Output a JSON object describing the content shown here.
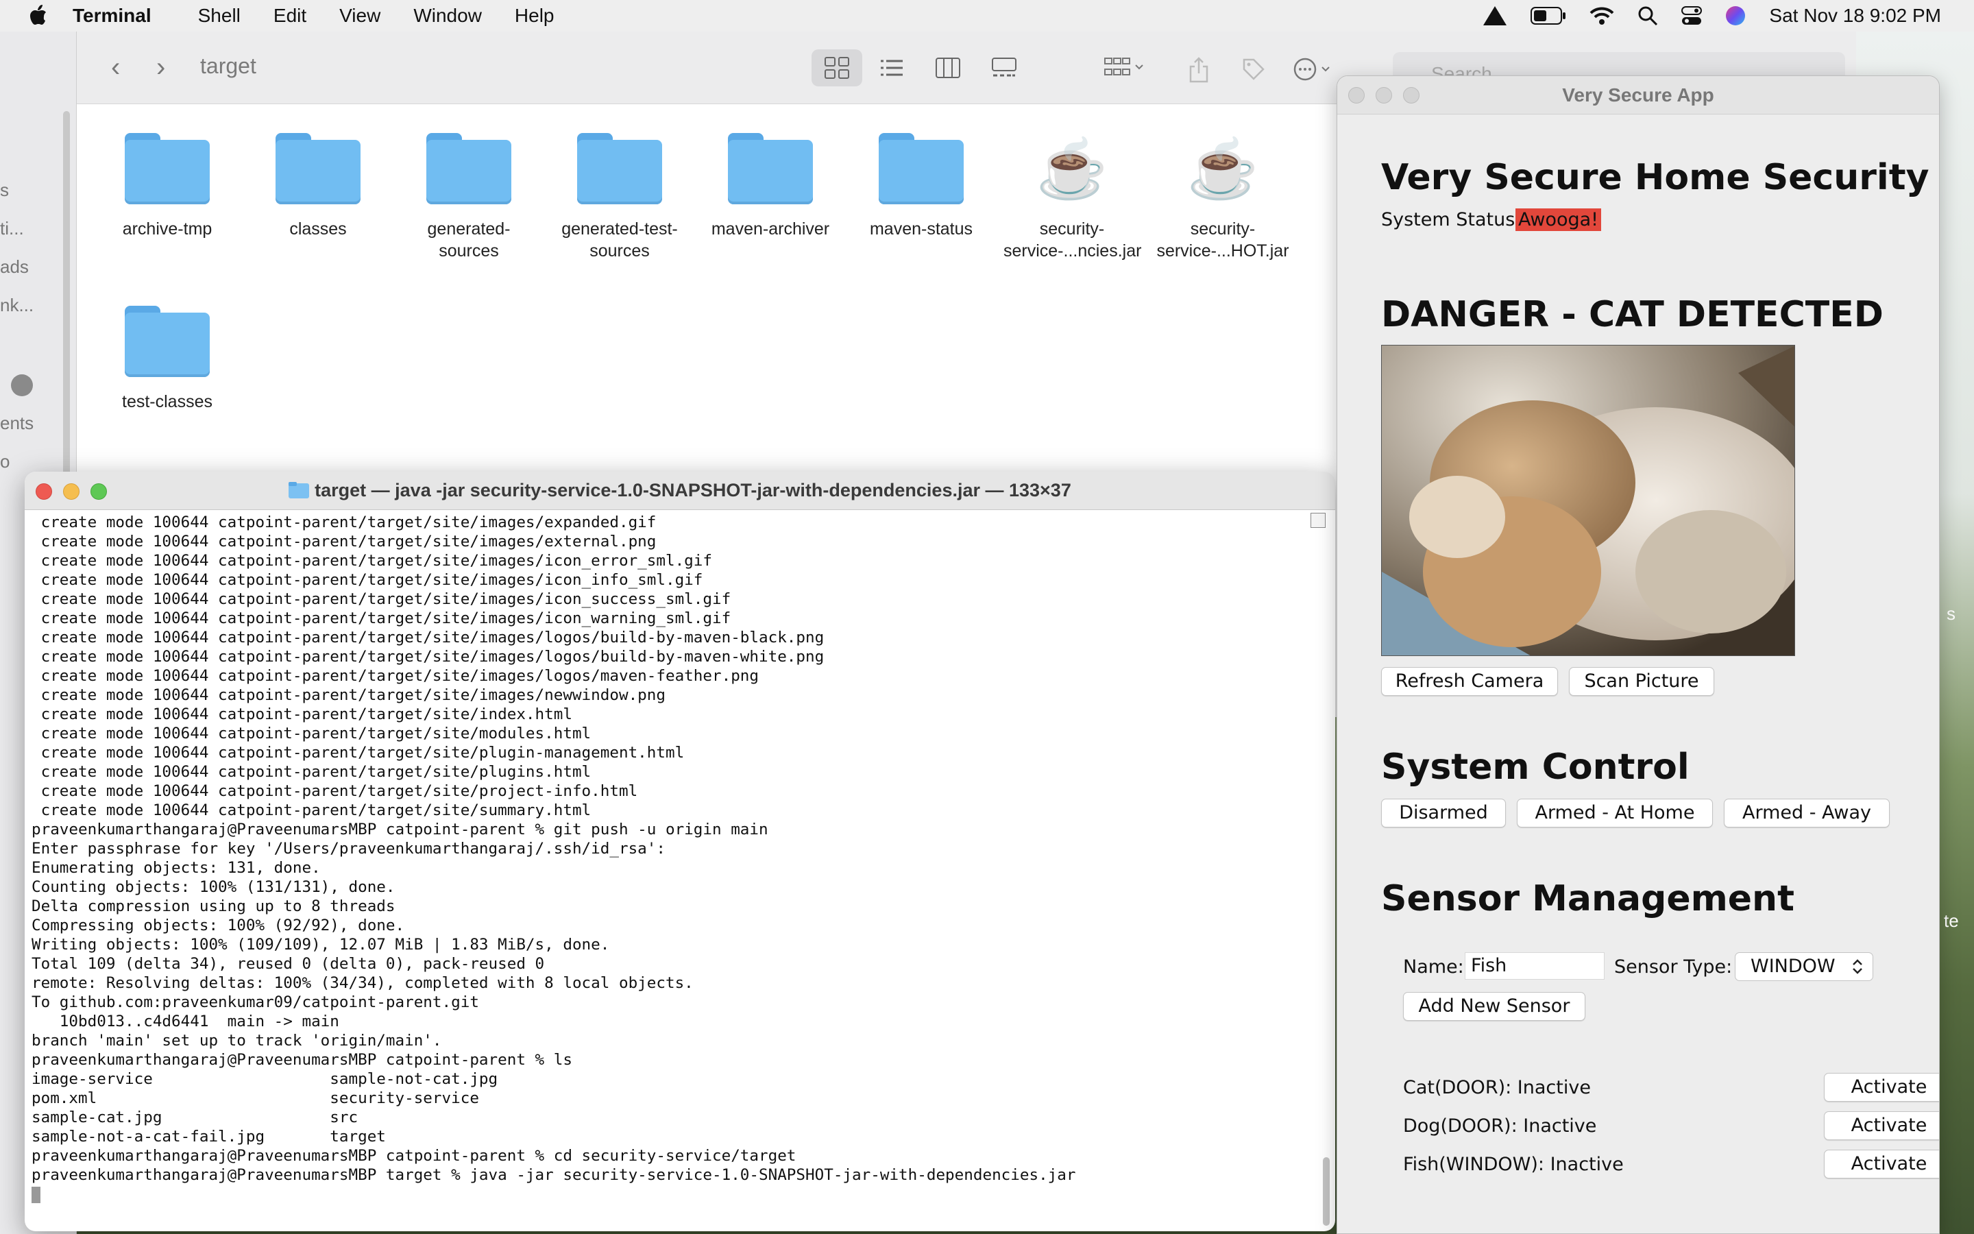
{
  "menubar": {
    "app_name": "Terminal",
    "menus": [
      "Shell",
      "Edit",
      "View",
      "Window",
      "Help"
    ],
    "clock": "Sat Nov 18  9:02 PM",
    "status_icons": [
      "warning-icon",
      "battery-icon",
      "wifi-icon",
      "search-icon",
      "control-center-icon",
      "siri-icon"
    ]
  },
  "sidebar": {
    "fragments": [
      "s",
      "ti...",
      "ads",
      "nk...",
      "ents",
      "o"
    ]
  },
  "finder": {
    "title": "target",
    "search_placeholder": "Search",
    "items": [
      {
        "label": "archive-tmp",
        "kind": "folder"
      },
      {
        "label": "classes",
        "kind": "folder"
      },
      {
        "label": "generated-sources",
        "line1": "generated-",
        "line2": "sources",
        "kind": "folder"
      },
      {
        "label": "generated-test-sources",
        "line1": "generated-test-",
        "line2": "sources",
        "kind": "folder"
      },
      {
        "label": "maven-archiver",
        "kind": "folder"
      },
      {
        "label": "maven-status",
        "kind": "folder"
      },
      {
        "label": "security-service-...ncies.jar",
        "line1": "security-",
        "line2": "service-...ncies.jar",
        "kind": "jar"
      },
      {
        "label": "security-service-...HOT.jar",
        "line1": "security-",
        "line2": "service-...HOT.jar",
        "kind": "jar"
      },
      {
        "label": "test-classes",
        "kind": "folder"
      }
    ]
  },
  "terminal": {
    "title": "target — java -jar security-service-1.0-SNAPSHOT-jar-with-dependencies.jar — 133×37",
    "lines": [
      " create mode 100644 catpoint-parent/target/site/images/expanded.gif",
      " create mode 100644 catpoint-parent/target/site/images/external.png",
      " create mode 100644 catpoint-parent/target/site/images/icon_error_sml.gif",
      " create mode 100644 catpoint-parent/target/site/images/icon_info_sml.gif",
      " create mode 100644 catpoint-parent/target/site/images/icon_success_sml.gif",
      " create mode 100644 catpoint-parent/target/site/images/icon_warning_sml.gif",
      " create mode 100644 catpoint-parent/target/site/images/logos/build-by-maven-black.png",
      " create mode 100644 catpoint-parent/target/site/images/logos/build-by-maven-white.png",
      " create mode 100644 catpoint-parent/target/site/images/logos/maven-feather.png",
      " create mode 100644 catpoint-parent/target/site/images/newwindow.png",
      " create mode 100644 catpoint-parent/target/site/index.html",
      " create mode 100644 catpoint-parent/target/site/modules.html",
      " create mode 100644 catpoint-parent/target/site/plugin-management.html",
      " create mode 100644 catpoint-parent/target/site/plugins.html",
      " create mode 100644 catpoint-parent/target/site/project-info.html",
      " create mode 100644 catpoint-parent/target/site/summary.html",
      "praveenkumarthangaraj@PraveenumarsMBP catpoint-parent % git push -u origin main",
      "Enter passphrase for key '/Users/praveenkumarthangaraj/.ssh/id_rsa':",
      "Enumerating objects: 131, done.",
      "Counting objects: 100% (131/131), done.",
      "Delta compression using up to 8 threads",
      "Compressing objects: 100% (92/92), done.",
      "Writing objects: 100% (109/109), 12.07 MiB | 1.83 MiB/s, done.",
      "Total 109 (delta 34), reused 0 (delta 0), pack-reused 0",
      "remote: Resolving deltas: 100% (34/34), completed with 8 local objects.",
      "To github.com:praveenkumar09/catpoint-parent.git",
      "   10bd013..c4d6441  main -> main",
      "branch 'main' set up to track 'origin/main'.",
      "praveenkumarthangaraj@PraveenumarsMBP catpoint-parent % ls",
      "image-service                   sample-not-cat.jpg",
      "pom.xml                         security-service",
      "sample-cat.jpg                  src",
      "sample-not-a-cat-fail.jpg       target",
      "praveenkumarthangaraj@PraveenumarsMBP catpoint-parent % cd security-service/target",
      "praveenkumarthangaraj@PraveenumarsMBP target % java -jar security-service-1.0-SNAPSHOT-jar-with-dependencies.jar"
    ]
  },
  "app": {
    "window_title": "Very Secure App",
    "heading": "Very Secure Home Security",
    "status_label": "System Status:",
    "status_value": "Awooga!",
    "status_color": "#e2473b",
    "alert_heading": "DANGER - CAT DETECTED",
    "refresh_button": "Refresh Camera",
    "scan_button": "Scan Picture",
    "control_heading": "System Control",
    "control_buttons": [
      "Disarmed",
      "Armed - At Home",
      "Armed - Away"
    ],
    "sensor_heading": "Sensor Management",
    "name_label": "Name:",
    "name_value": "Fish",
    "type_label": "Sensor Type:",
    "type_value": "WINDOW",
    "add_button": "Add New Sensor",
    "sensors": [
      {
        "label": "Cat(DOOR): Inactive",
        "action": "Activate"
      },
      {
        "label": "Dog(DOOR): Inactive",
        "action": "Activate"
      },
      {
        "label": "Fish(WINDOW): Inactive",
        "action": "Activate"
      }
    ]
  },
  "desktop": {
    "edge_fragments": [
      "s",
      "te"
    ]
  }
}
